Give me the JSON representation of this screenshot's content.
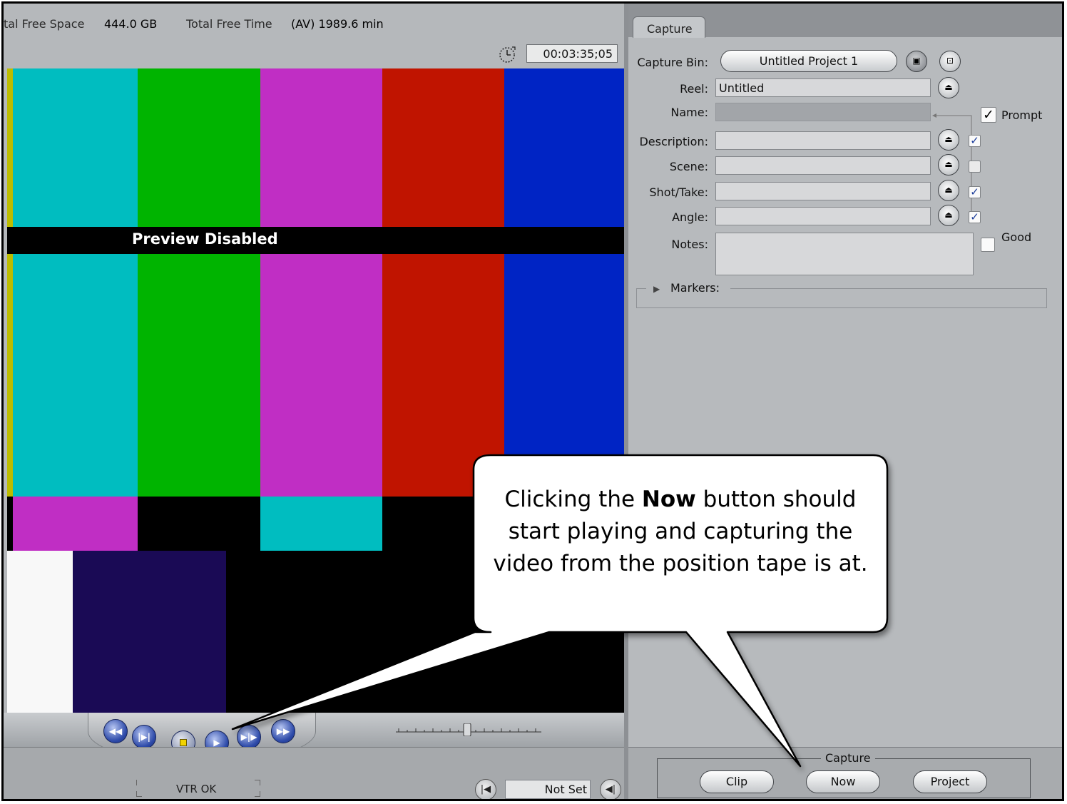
{
  "info": {
    "free_space_label": "tal Free Space",
    "free_space_value": "444.0 GB",
    "free_time_label": "Total Free Time",
    "free_time_value": "(AV) 1989.6 min",
    "duration_timecode": "00:03:35;05"
  },
  "viewer": {
    "preview_status": "Preview Disabled",
    "vtr_status": "VTR OK",
    "out_point": "Not Set"
  },
  "panel": {
    "tab_label": "Capture",
    "fields": {
      "capture_bin_label": "Capture Bin:",
      "capture_bin_value": "Untitled Project 1",
      "reel_label": "Reel:",
      "reel_value": "Untitled",
      "name_label": "Name:",
      "prompt_label": "Prompt",
      "description_label": "Description:",
      "scene_label": "Scene:",
      "shot_take_label": "Shot/Take:",
      "angle_label": "Angle:",
      "notes_label": "Notes:",
      "good_label": "Good",
      "markers_label": "Markers:"
    },
    "checkboxes": {
      "prompt": true,
      "description": true,
      "scene": false,
      "shot_take": true,
      "angle": true,
      "good": false
    }
  },
  "capture_footer": {
    "group_label": "Capture",
    "clip_label": "Clip",
    "now_label": "Now",
    "project_label": "Project"
  },
  "callout": {
    "text_before": "Clicking the ",
    "text_bold": "Now",
    "text_after": " button should start playing and capturing the video from the position tape is at."
  },
  "colors": {
    "cyan": "#00bdc0",
    "green": "#00b400",
    "magenta": "#c02ec4",
    "red": "#c01400",
    "blue": "#0024c4",
    "yellow": "#bcbc00",
    "navy": "#1a0a55",
    "white": "#f8f8f8"
  }
}
